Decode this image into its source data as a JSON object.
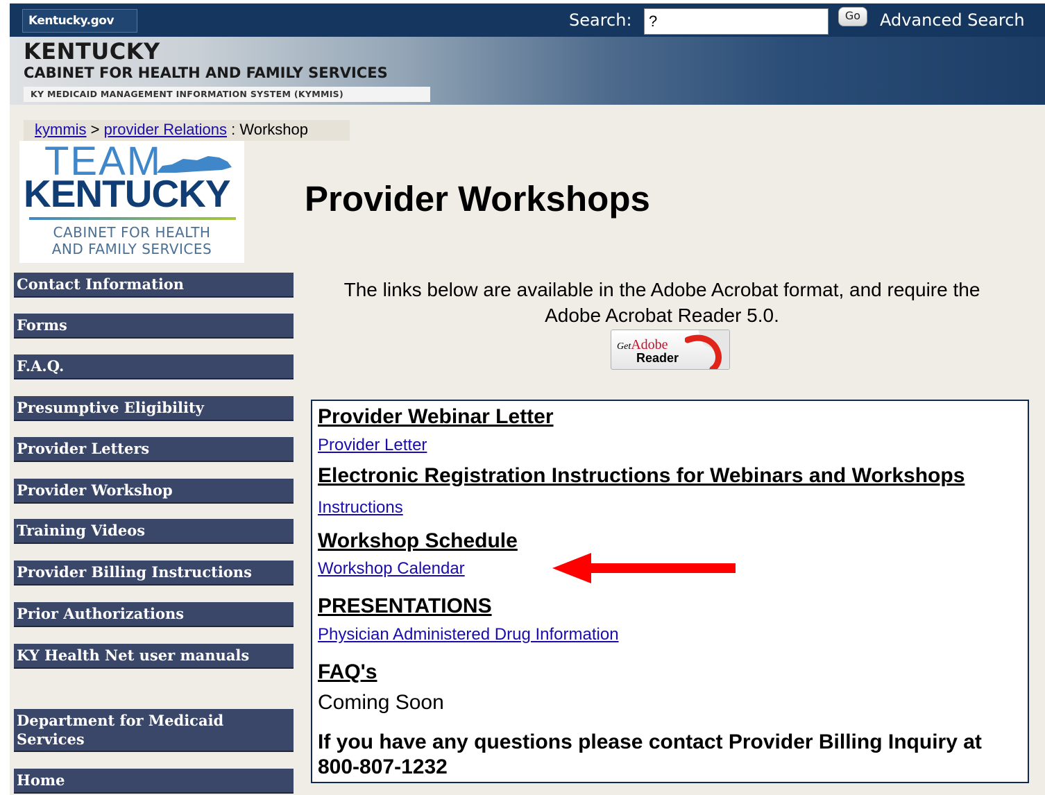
{
  "header": {
    "kygov_label": "Kentucky.gov",
    "search_label": "Search:",
    "search_value": "?",
    "go_label": "Go",
    "advanced_search_label": "Advanced Search"
  },
  "banner": {
    "state": "KENTUCKY",
    "cabinet": "CABINET FOR HEALTH AND FAMILY SERVICES",
    "system": "KY MEDICAID MANAGEMENT INFORMATION SYSTEM (KYMMIS)"
  },
  "breadcrumb": {
    "link1": "kymmis",
    "sep1": ">",
    "link2": "provider Relations",
    "sep2": ":",
    "current": "Workshop"
  },
  "logo": {
    "team": "TEAM",
    "kentucky": "KENTUCKY",
    "line1": "CABINET FOR HEALTH",
    "line2": "AND FAMILY SERVICES"
  },
  "sidebar": {
    "items": [
      {
        "label": "Contact Information"
      },
      {
        "label": "Forms"
      },
      {
        "label": "F.A.Q."
      },
      {
        "label": "Presumptive Eligibility"
      },
      {
        "label": "Provider Letters"
      },
      {
        "label": "Provider Workshop"
      },
      {
        "label": "Training Videos"
      },
      {
        "label": "Provider Billing Instructions"
      },
      {
        "label": "Prior Authorizations"
      },
      {
        "label": "KY Health Net user manuals"
      },
      {
        "label": "Department for Medicaid Services"
      },
      {
        "label": "Home"
      }
    ]
  },
  "main": {
    "title": "Provider Workshops",
    "intro": "The links below are available in the Adobe Acrobat format, and require the Adobe Acrobat Reader 5.0.",
    "adobe": {
      "get": "Get",
      "brand": "Adobe",
      "reader": "Reader"
    },
    "sections": {
      "webinar_heading": "Provider Webinar Letter",
      "webinar_link": "Provider Letter",
      "registration_heading": "Electronic Registration Instructions for Webinars and Workshops",
      "registration_link": "Instructions",
      "schedule_heading": "Workshop Schedule",
      "schedule_link": "Workshop Calendar",
      "presentations_heading": "PRESENTATIONS",
      "presentations_link": "Physician Administered Drug Information",
      "faq_heading": "FAQ's",
      "faq_text": "Coming Soon",
      "contact_text": "If you have any questions please contact Provider Billing Inquiry at 800-807-1232"
    }
  },
  "annotation": {
    "arrow_color": "#ff0000"
  }
}
